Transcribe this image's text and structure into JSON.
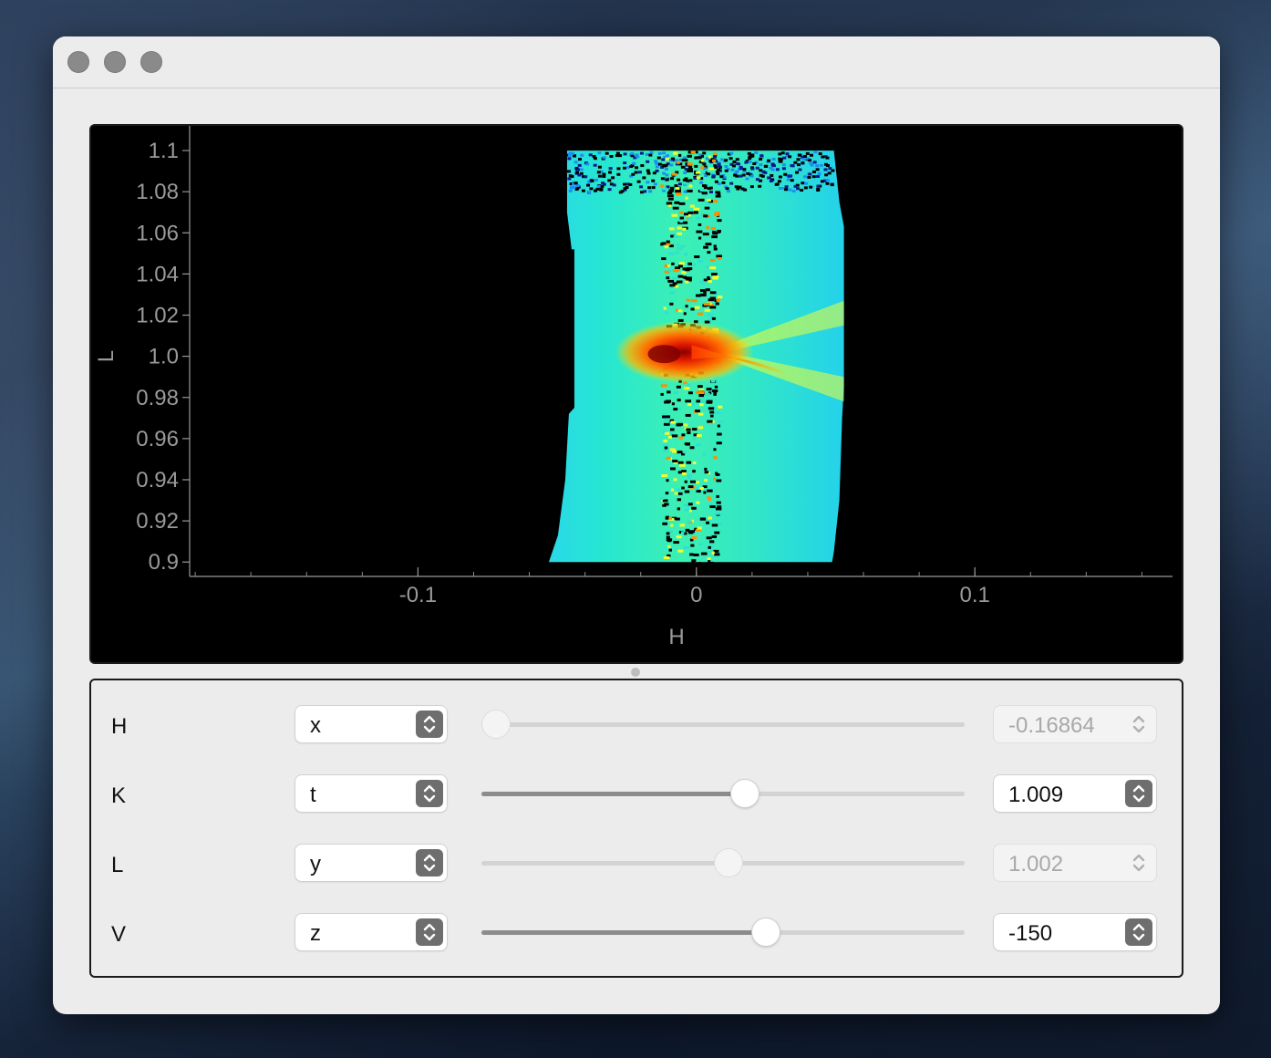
{
  "chart_data": {
    "type": "heatmap",
    "title": "",
    "xlabel": "H",
    "ylabel": "L",
    "xlim": [
      -0.182,
      0.171
    ],
    "ylim": [
      1.112,
      0.893
    ],
    "x_ticks": [
      "-0.1",
      "0",
      "0.1"
    ],
    "x_tick_values": [
      -0.1,
      0,
      0.1
    ],
    "y_ticks": [
      "0.9",
      "0.92",
      "0.94",
      "0.96",
      "0.98",
      "1.0",
      "1.02",
      "1.04",
      "1.06",
      "1.08",
      "1.1"
    ],
    "y_tick_values": [
      0.9,
      0.92,
      0.94,
      0.96,
      0.98,
      1.0,
      1.02,
      1.04,
      1.06,
      1.08,
      1.1
    ],
    "colormap": "jet",
    "background": "#000000",
    "data_region": {
      "h_range": [
        -0.053,
        0.052
      ],
      "l_range": [
        0.9,
        1.1
      ],
      "peak": {
        "H": -0.005,
        "L": 1.002
      },
      "streak_toward": {
        "H": 0.035,
        "L": 0.99
      },
      "dark_gap_near_H": 0.0,
      "low_intensity_below_L": 1.082
    }
  },
  "window": {
    "traffic_color": "#8a8a8a"
  },
  "controls": [
    {
      "label": "H",
      "axis": "x",
      "value": "-0.16864",
      "slider_fraction": 0.03,
      "enabled": false
    },
    {
      "label": "K",
      "axis": "t",
      "value": "1.009",
      "slider_fraction": 0.546,
      "enabled": true
    },
    {
      "label": "L",
      "axis": "y",
      "value": "1.002",
      "slider_fraction": 0.512,
      "enabled": false
    },
    {
      "label": "V",
      "axis": "z",
      "value": "-150",
      "slider_fraction": 0.588,
      "enabled": true
    }
  ]
}
